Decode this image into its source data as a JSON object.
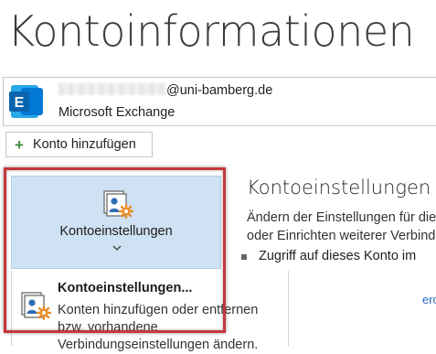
{
  "page": {
    "title": "Kontoinformationen"
  },
  "account": {
    "email_suffix": "@uni-bamberg.de",
    "type": "Microsoft Exchange",
    "logo": "exchange-logo-icon"
  },
  "add_account": {
    "icon": "plus-icon",
    "label": "Konto hinzufügen"
  },
  "settings_card": {
    "icon": "account-settings-icon",
    "label": "Kontoeinstellungen",
    "chevron": "chevron-down-icon"
  },
  "dropdown": {
    "item": {
      "icon": "account-settings-icon",
      "title": "Kontoeinstellungen...",
      "description": "Konten hinzufügen oder entfernen bzw. vorhandene Verbindungseinstellungen ändern."
    }
  },
  "section": {
    "title": "Kontoeinstellungen",
    "desc_line1": "Ändern der Einstellungen für die",
    "desc_line2": "oder Einrichten weiterer Verbind",
    "bullet": "Zugriff auf dieses Konto im",
    "link_snip": "ero"
  },
  "colors": {
    "highlight": "#c8363b",
    "card_bg": "#cfe2f3",
    "plus": "#3f8f3f",
    "exchange_blue": "#0a64ad"
  }
}
